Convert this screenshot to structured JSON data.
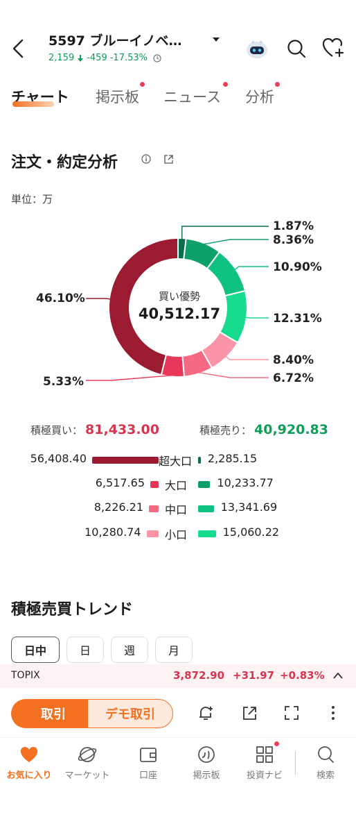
{
  "header": {
    "title": "5597 ブルーイノベ…",
    "price": "2,159",
    "change": "-459",
    "change_pct": "-17.53%"
  },
  "tabs": [
    {
      "label": "チャート",
      "active": true,
      "dot": false
    },
    {
      "label": "掲示板",
      "active": false,
      "dot": true
    },
    {
      "label": "ニュース",
      "active": false,
      "dot": true
    },
    {
      "label": "分析",
      "active": false,
      "dot": true
    }
  ],
  "section": {
    "title": "注文・約定分析",
    "unit": "単位：万"
  },
  "donut": {
    "center_label": "買い優勢",
    "center_value": "40,512.17",
    "slices": [
      {
        "pct": "1.87%",
        "value": 1.87,
        "color": "#0b6e4a",
        "side": "sell"
      },
      {
        "pct": "8.36%",
        "value": 8.36,
        "color": "#0ea06b",
        "side": "sell"
      },
      {
        "pct": "10.90%",
        "value": 10.9,
        "color": "#10c27f",
        "side": "sell"
      },
      {
        "pct": "12.31%",
        "value": 12.31,
        "color": "#17db8e",
        "side": "sell"
      },
      {
        "pct": "8.40%",
        "value": 8.4,
        "color": "#fb94a6",
        "side": "buy"
      },
      {
        "pct": "6.72%",
        "value": 6.72,
        "color": "#f36a82",
        "side": "buy"
      },
      {
        "pct": "5.33%",
        "value": 5.33,
        "color": "#e8385a",
        "side": "buy"
      },
      {
        "pct": "46.10%",
        "value": 46.1,
        "color": "#9b1c31",
        "side": "buy"
      }
    ]
  },
  "totals": {
    "buy_label": "積極買い：",
    "buy_value": "81,433.00",
    "sell_label": "積極売り：",
    "sell_value": "40,920.83"
  },
  "breakdown": [
    {
      "label": "超大口",
      "buy": "56,408.40",
      "buy_num": 56408.4,
      "sell": "2,285.15",
      "sell_num": 2285.15,
      "buy_color": "#9b1c31",
      "sell_color": "#0b6e4a"
    },
    {
      "label": "大口",
      "buy": "6,517.65",
      "buy_num": 6517.65,
      "sell": "10,233.77",
      "sell_num": 10233.77,
      "buy_color": "#e8385a",
      "sell_color": "#0ea06b"
    },
    {
      "label": "中口",
      "buy": "8,226.21",
      "buy_num": 8226.21,
      "sell": "13,341.69",
      "sell_num": 13341.69,
      "buy_color": "#f36a82",
      "sell_color": "#10c27f"
    },
    {
      "label": "小口",
      "buy": "10,280.74",
      "buy_num": 10280.74,
      "sell": "15,060.22",
      "sell_num": 15060.22,
      "buy_color": "#fb94a6",
      "sell_color": "#17db8e"
    }
  ],
  "trend": {
    "title": "積極売買トレンド",
    "periods": [
      {
        "label": "日中",
        "active": true
      },
      {
        "label": "日",
        "active": false
      },
      {
        "label": "週",
        "active": false
      },
      {
        "label": "月",
        "active": false
      }
    ]
  },
  "index_bar": {
    "name": "TOPIX",
    "value": "3,872.90",
    "change": "+31.97",
    "change_pct": "+0.83%"
  },
  "actions": {
    "trade": "取引",
    "demo_trade": "デモ取引"
  },
  "nav": [
    {
      "label": "お気に入り",
      "icon": "heart-icon",
      "active": true
    },
    {
      "label": "マーケット",
      "icon": "planet-icon",
      "active": false
    },
    {
      "label": "口座",
      "icon": "wallet-icon",
      "active": false
    },
    {
      "label": "掲示板",
      "icon": "board-icon",
      "active": false
    },
    {
      "label": "投資ナビ",
      "icon": "grid-icon",
      "active": false
    },
    {
      "label": "検索",
      "icon": "search-icon",
      "active": false
    }
  ],
  "colors": {
    "accent": "#f37021",
    "up": "#d9344f",
    "down": "#0f9d58"
  }
}
